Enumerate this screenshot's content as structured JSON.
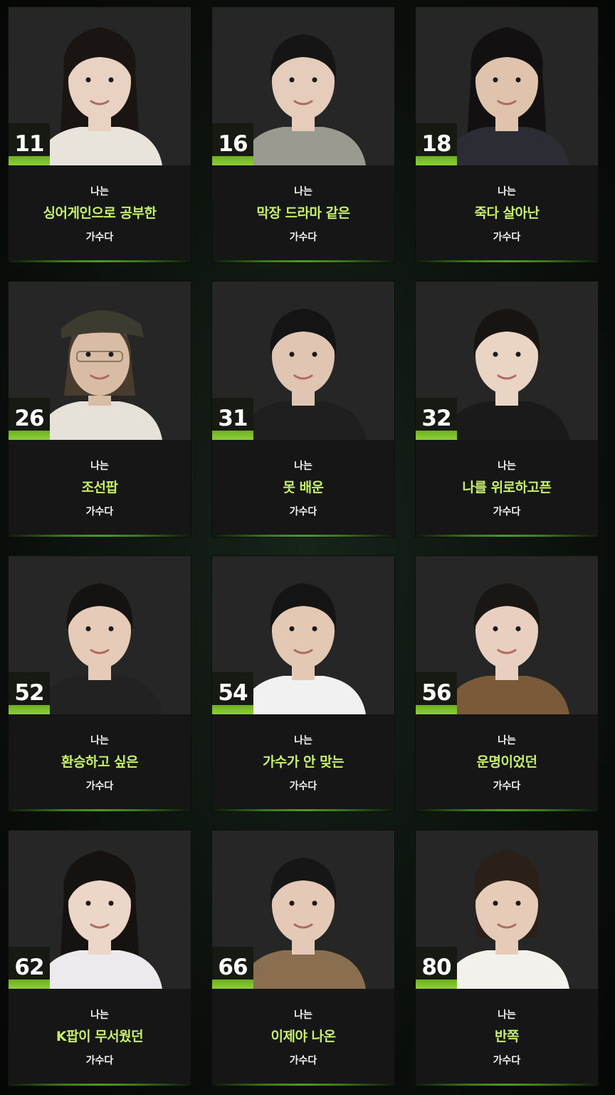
{
  "cards": [
    {
      "number": "11",
      "top": "나는",
      "main": "싱어게인으로 공부한",
      "bottom": "가수다"
    },
    {
      "number": "16",
      "top": "나는",
      "main": "막장 드라마 같은",
      "bottom": "가수다"
    },
    {
      "number": "18",
      "top": "나는",
      "main": "죽다 살아난",
      "bottom": "가수다"
    },
    {
      "number": "26",
      "top": "나는",
      "main": "조선팝",
      "bottom": "가수다"
    },
    {
      "number": "31",
      "top": "나는",
      "main": "못 배운",
      "bottom": "가수다"
    },
    {
      "number": "32",
      "top": "나는",
      "main": "나를 위로하고픈",
      "bottom": "가수다"
    },
    {
      "number": "52",
      "top": "나는",
      "main": "환승하고 싶은",
      "bottom": "가수다"
    },
    {
      "number": "54",
      "top": "나는",
      "main": "가수가 안 맞는",
      "bottom": "가수다"
    },
    {
      "number": "56",
      "top": "나는",
      "main": "운명이었던",
      "bottom": "가수다"
    },
    {
      "number": "62",
      "top": "나는",
      "main": "K팝이 무서웠던",
      "bottom": "가수다"
    },
    {
      "number": "66",
      "top": "나는",
      "main": "이제야 나온",
      "bottom": "가수다"
    },
    {
      "number": "80",
      "top": "나는",
      "main": "반쪽",
      "bottom": "가수다"
    }
  ],
  "colors": {
    "accent_green": "#8bd135",
    "highlight_text": "#c6f06a"
  },
  "photos": [
    {
      "hair": "#1a1512",
      "top": "#e8e4dc",
      "skin": "#e9d2c2",
      "style": "long"
    },
    {
      "hair": "#151515",
      "top": "#9a9a90",
      "skin": "#e6cdbb",
      "style": "short"
    },
    {
      "hair": "#121010",
      "top": "#2c2c34",
      "skin": "#dfc3ad",
      "style": "long"
    },
    {
      "hair": "#3d3a30",
      "top": "#e6e2da",
      "skin": "#d9bca4",
      "style": "hat"
    },
    {
      "hair": "#141414",
      "top": "#1f1f1f",
      "skin": "#e0c6b2",
      "style": "short"
    },
    {
      "hair": "#181412",
      "top": "#1a1a1a",
      "skin": "#ead4c4",
      "style": "short"
    },
    {
      "hair": "#151312",
      "top": "#222222",
      "skin": "#e6cbb8",
      "style": "short"
    },
    {
      "hair": "#141414",
      "top": "#f1f1f1",
      "skin": "#e3c8b4",
      "style": "short"
    },
    {
      "hair": "#1a1614",
      "top": "#7a5a38",
      "skin": "#e8cfbf",
      "style": "short"
    },
    {
      "hair": "#161210",
      "top": "#ece9ef",
      "skin": "#ecd6c8",
      "style": "long"
    },
    {
      "hair": "#161616",
      "top": "#8a6e50",
      "skin": "#e3c9b6",
      "style": "short"
    },
    {
      "hair": "#2a2018",
      "top": "#f3f1ec",
      "skin": "#e6cbb9",
      "style": "bun"
    }
  ]
}
